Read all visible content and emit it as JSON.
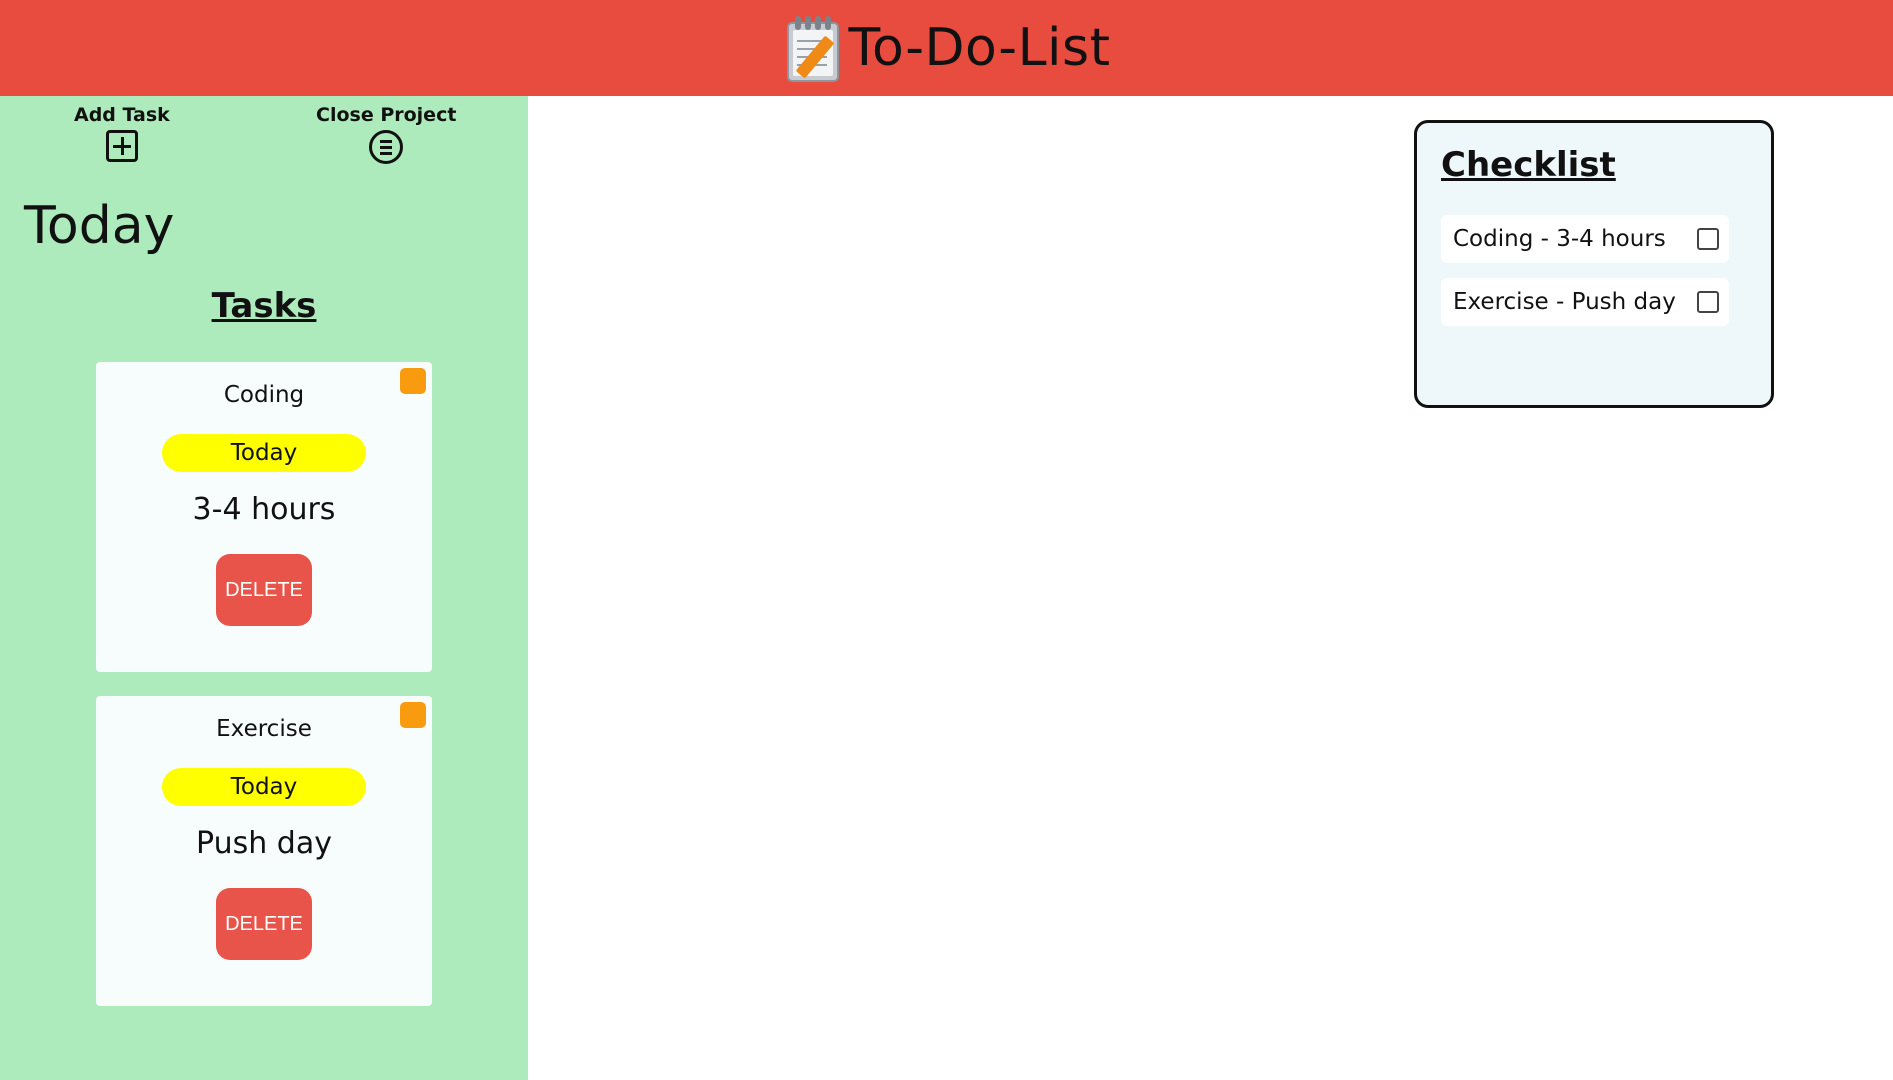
{
  "header": {
    "title": "To-Do-List",
    "icon": "notepad-pencil-icon",
    "background": "#e84c3f"
  },
  "sidebar": {
    "background": "#aeebbc",
    "actions": [
      {
        "label": "Add Task",
        "icon": "plus-square-icon"
      },
      {
        "label": "Close Project",
        "icon": "menu-circle-icon"
      }
    ],
    "project_name": "Today",
    "tasks_heading": "Tasks"
  },
  "tasks": [
    {
      "title": "Coding",
      "due": "Today",
      "description": "3-4 hours",
      "delete_label": "DELETE",
      "priority_color": "#f99b0e"
    },
    {
      "title": "Exercise",
      "due": "Today",
      "description": "Push day",
      "delete_label": "DELETE",
      "priority_color": "#f99b0e"
    }
  ],
  "checklist": {
    "title": "Checklist",
    "items": [
      {
        "label": "Coding - 3-4 hours",
        "checked": false
      },
      {
        "label": "Exercise - Push day",
        "checked": false
      }
    ]
  },
  "colors": {
    "due_badge": "#ffff00",
    "delete_button": "#e8534a"
  }
}
